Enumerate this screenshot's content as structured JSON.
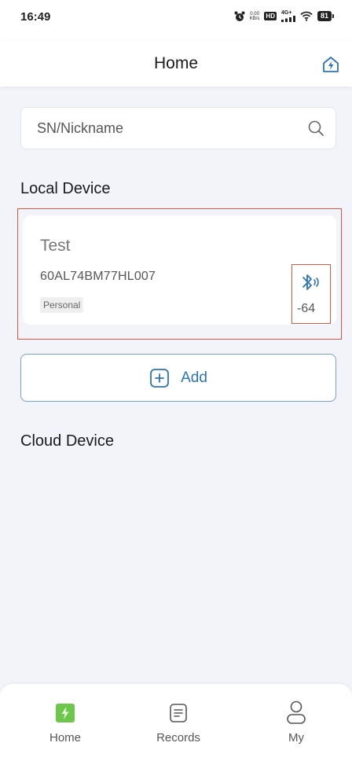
{
  "status_bar": {
    "time": "16:49",
    "net_speed_value": "0.00",
    "net_speed_unit": "KB/s",
    "hd_label": "HD",
    "signal_label": "4G+",
    "battery": "81"
  },
  "header": {
    "title": "Home",
    "action_icon": "bolt-home-icon"
  },
  "search": {
    "placeholder": "SN/Nickname",
    "value": ""
  },
  "local_device": {
    "section_title": "Local Device",
    "devices": [
      {
        "name": "Test",
        "serial": "60AL74BM77HL007",
        "tag": "Personal",
        "rssi": "-64",
        "connection_icon": "bluetooth-icon"
      }
    ]
  },
  "add_button": {
    "label": "Add",
    "icon": "plus-square-icon"
  },
  "cloud_device": {
    "section_title": "Cloud Device"
  },
  "tabbar": {
    "items": [
      {
        "label": "Home",
        "icon": "home-bolt-icon",
        "active": true
      },
      {
        "label": "Records",
        "icon": "records-icon",
        "active": false
      },
      {
        "label": "My",
        "icon": "person-icon",
        "active": false
      }
    ]
  },
  "colors": {
    "accent_blue": "#2b74b4",
    "active_tab_green": "#6cc74a",
    "highlight_red": "#e0553f",
    "background": "#f2f4fa"
  }
}
